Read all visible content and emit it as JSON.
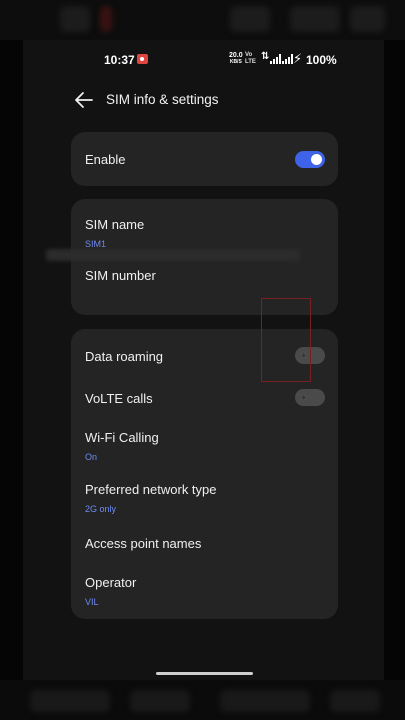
{
  "status_bar": {
    "time": "10:37",
    "net_speed_value": "20.0",
    "net_speed_unit": "KB/S",
    "volte_label": "Vo LTE",
    "battery": "100%"
  },
  "header": {
    "title": "SIM info & settings",
    "back_icon": "arrow-left-icon"
  },
  "enable_card": {
    "label": "Enable",
    "enabled": true
  },
  "sim_card": {
    "name_label": "SIM name",
    "name_value": "SIM1",
    "number_label": "SIM number"
  },
  "settings_card": {
    "data_roaming": {
      "label": "Data roaming",
      "enabled": false
    },
    "volte_calls": {
      "label": "VoLTE calls",
      "enabled": false
    },
    "wifi_calling": {
      "label": "Wi-Fi Calling",
      "value": "On"
    },
    "preferred_network": {
      "label": "Preferred network type",
      "value": "2G only"
    },
    "apn": {
      "label": "Access point names"
    },
    "operator": {
      "label": "Operator",
      "value": "VIL"
    }
  },
  "colors": {
    "accent": "#3f63e8",
    "subtext": "#6f8cf2",
    "card": "#242424",
    "background": "#121212"
  }
}
